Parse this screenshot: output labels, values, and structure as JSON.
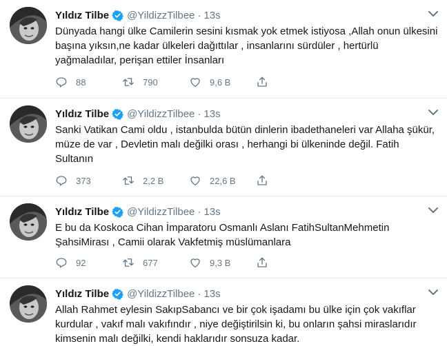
{
  "tweets": [
    {
      "name": "Yıldız Tilbe",
      "handle": "@YildizzTilbee",
      "separator": "·",
      "time": "13s",
      "text": "Dünyada hangi ülke Camilerin sesini kısmak yok etmek istiyosa ,Allah onun ülkesini başına yıksın,ne kadar ülkeleri dağıttılar , insanlarını sürdüler , hertürlü yağmaladılar, perişan ettiler İnsanları",
      "replies": "88",
      "retweets": "790",
      "likes": "9,6 B"
    },
    {
      "name": "Yıldız Tilbe",
      "handle": "@YildizzTilbee",
      "separator": "·",
      "time": "13s",
      "text": "Sanki Vatikan Cami oldu  , istanbulda bütün dinlerin ibadethaneleri var Allaha şükür,  müze de var , Devletin malı değilki orası , herhangi bi ülkeninde değil. Fatih Sultanın",
      "replies": "373",
      "retweets": "2,2 B",
      "likes": "22,6 B"
    },
    {
      "name": "Yıldız Tilbe",
      "handle": "@YildizzTilbee",
      "separator": "·",
      "time": "13s",
      "text": "E bu da Koskoca Cihan İmparatoru Osmanlı Aslanı FatihSultanMehmetin ŞahsiMirası , Camii olarak Vakfetmiş müslümanlara",
      "replies": "92",
      "retweets": "677",
      "likes": "9,3 B"
    },
    {
      "name": "Yıldız Tilbe",
      "handle": "@YildizzTilbee",
      "separator": "·",
      "time": "13s",
      "text": "Allah Rahmet eylesin SakıpSabancı ve bir çok işadamı bu ülke için çok vakıflar kurdular , vakıf malı vakıfındır , niye değiştirilsin ki, bu onların şahsi miraslarıdır kimsenin malı değilki, kendi haklarıdır sonsuza kadar."
    }
  ],
  "colors": {
    "verified": "#1da1f2",
    "secondary_text": "#657786",
    "border": "#e6ecf0"
  },
  "icons": [
    "verified-badge-icon",
    "chevron-down-icon",
    "reply-icon",
    "retweet-icon",
    "like-icon",
    "share-icon"
  ]
}
